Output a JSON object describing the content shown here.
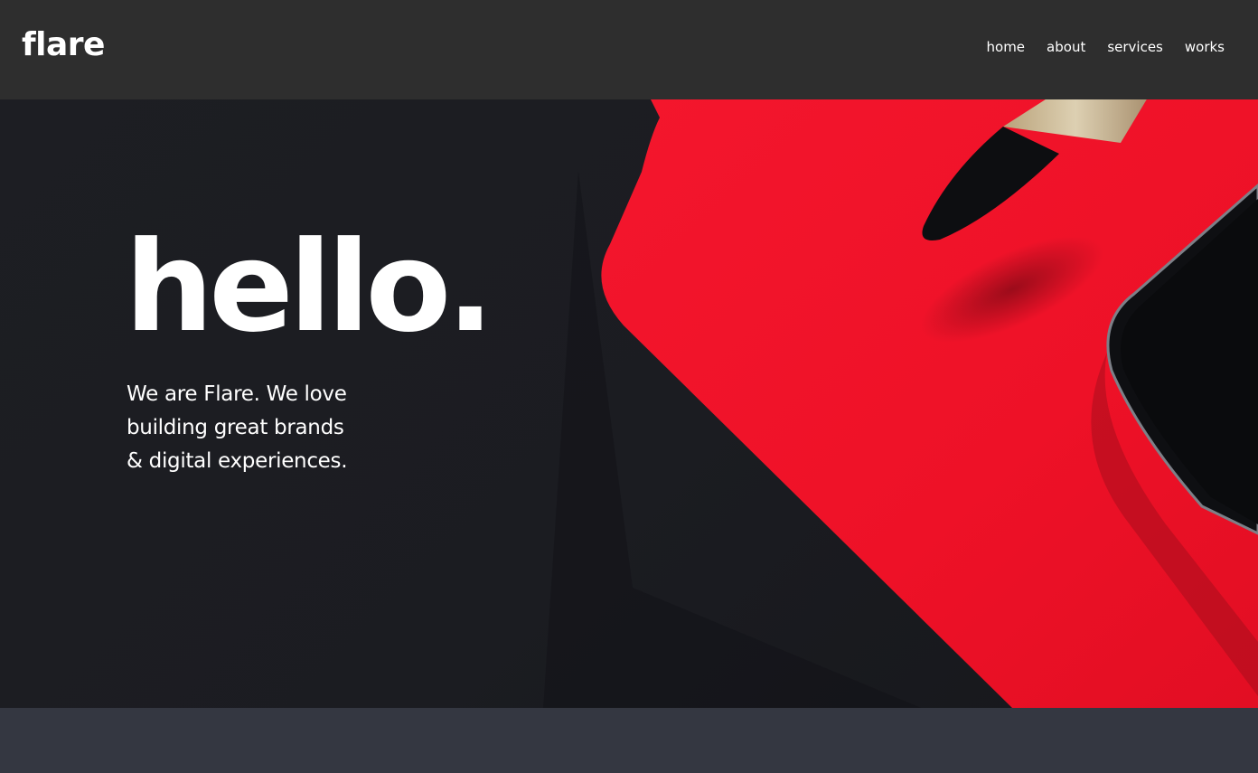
{
  "header": {
    "logo": "flare",
    "nav": [
      {
        "label": "home"
      },
      {
        "label": "about"
      },
      {
        "label": "services"
      },
      {
        "label": "works"
      }
    ]
  },
  "hero": {
    "title": "hello.",
    "subtitle": "We are Flare. We love building great brands & digital experiences."
  },
  "colors": {
    "header_bg": "#2e2e2e",
    "hero_bg": "#1c1d22",
    "accent_red": "#f0152b",
    "footer_bg": "#343741"
  }
}
